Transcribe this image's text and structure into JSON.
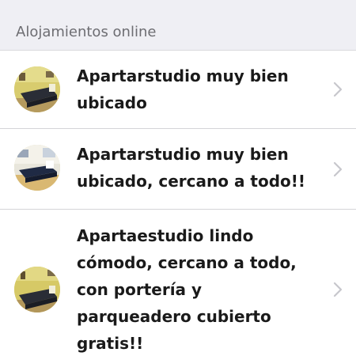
{
  "section": {
    "header_label": "Alojamientos online"
  },
  "listings": [
    {
      "title_line1": "Apartarstudio muy bien",
      "title_line2": "ubicado",
      "thumbnail_icon": "bedroom-photo",
      "action_icon": "chevron-right-icon"
    },
    {
      "title_line1": "Apartarstudio muy bien",
      "title_line2": "ubicado, cercano a todo!!",
      "thumbnail_icon": "bedroom-photo",
      "action_icon": "chevron-right-icon"
    },
    {
      "title_line1": "Apartaestudio lindo",
      "title_line2": "cómodo, cercano a todo,",
      "title_line3": "con portería y",
      "title_line4": "parqueadero cubierto",
      "title_line5": "gratis!!",
      "thumbnail_icon": "bedroom-photo",
      "action_icon": "chevron-right-icon"
    }
  ],
  "colors": {
    "header_background": "#efeff4",
    "header_text": "#6d6d72",
    "title_text": "#1a1a1a",
    "separator": "#d4d4d8",
    "chevron": "#c7c7cc"
  }
}
